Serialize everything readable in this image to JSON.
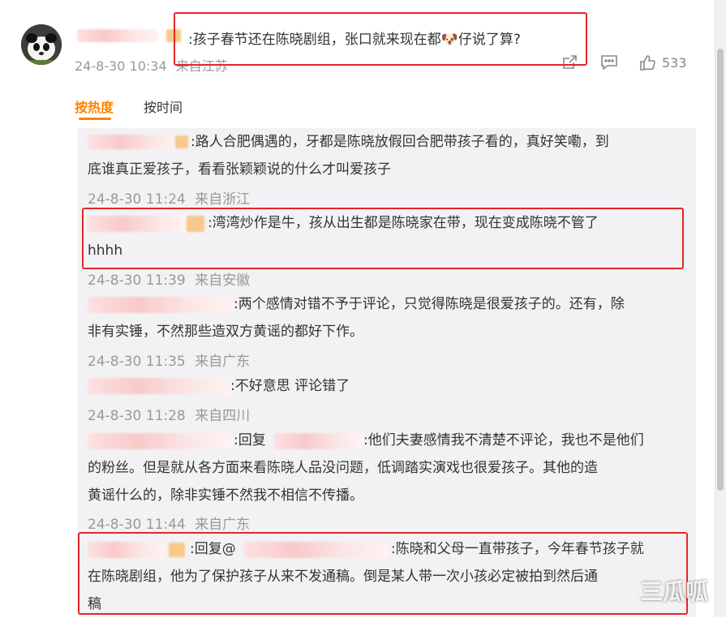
{
  "top_comment": {
    "text": ":孩子春节还在陈晓剧组，张口就来现在都🐶仔说了算?",
    "timestamp": "24-8-30 10:34",
    "location": "来自江苏",
    "like_count": "533"
  },
  "sort_tabs": {
    "by_hot": "按热度",
    "by_time": "按时间"
  },
  "replies": [
    {
      "text": ":路人合肥偶遇的，牙都是陈晓放假回合肥带孩子看的，真好笑嘞，到",
      "text2": "底谁真正爱孩子，看看张颖颖说的什么才叫爱孩子",
      "timestamp": "24-8-30 11:24",
      "location": "来自浙江"
    },
    {
      "text": ":湾湾炒作是牛，孩从出生都是陈晓家在带，现在变成陈晓不管了",
      "text2": "hhhh",
      "timestamp": "24-8-30 11:39",
      "location": "来自安徽"
    },
    {
      "text": ":两个感情对错不予于评论，只觉得陈晓是很爱孩子的。还有，除",
      "text2": "非有实锤，不然那些造双方黄谣的都好下作。",
      "timestamp": "24-8-30 11:35",
      "location": "来自广东"
    },
    {
      "text": ":不好意思 评论错了",
      "timestamp": "24-8-30 11:28",
      "location": "来自四川"
    },
    {
      "prefix": ":回复",
      "text": ":他们夫妻感情我不清楚不评论，我也不是他们",
      "text2": "的粉丝。但是就从各方面来看陈晓人品没问题，低调踏实演戏也很爱孩子。其他的造",
      "text3": "黄谣什么的，除非实锤不然我不相信不传播。",
      "timestamp": "24-8-30 11:44",
      "location": "来自广东"
    },
    {
      "prefix": ":回复@",
      "text": ":陈晓和父母一直带孩子，今年春节孩子就",
      "text2": "在陈晓剧组，他为了保护孩子从来不发通稿。倒是某人带一次小孩必定被拍到然后通",
      "text3": "稿"
    }
  ],
  "watermark": "三瓜呱",
  "colors": {
    "accent": "#ff8200",
    "highlight_box": "#e3262a",
    "timestamp": "#999999",
    "thread_background": "#f2f2f5"
  },
  "icons": {
    "share": "share-icon",
    "comment": "comment-icon",
    "like": "thumbs-up-icon"
  }
}
